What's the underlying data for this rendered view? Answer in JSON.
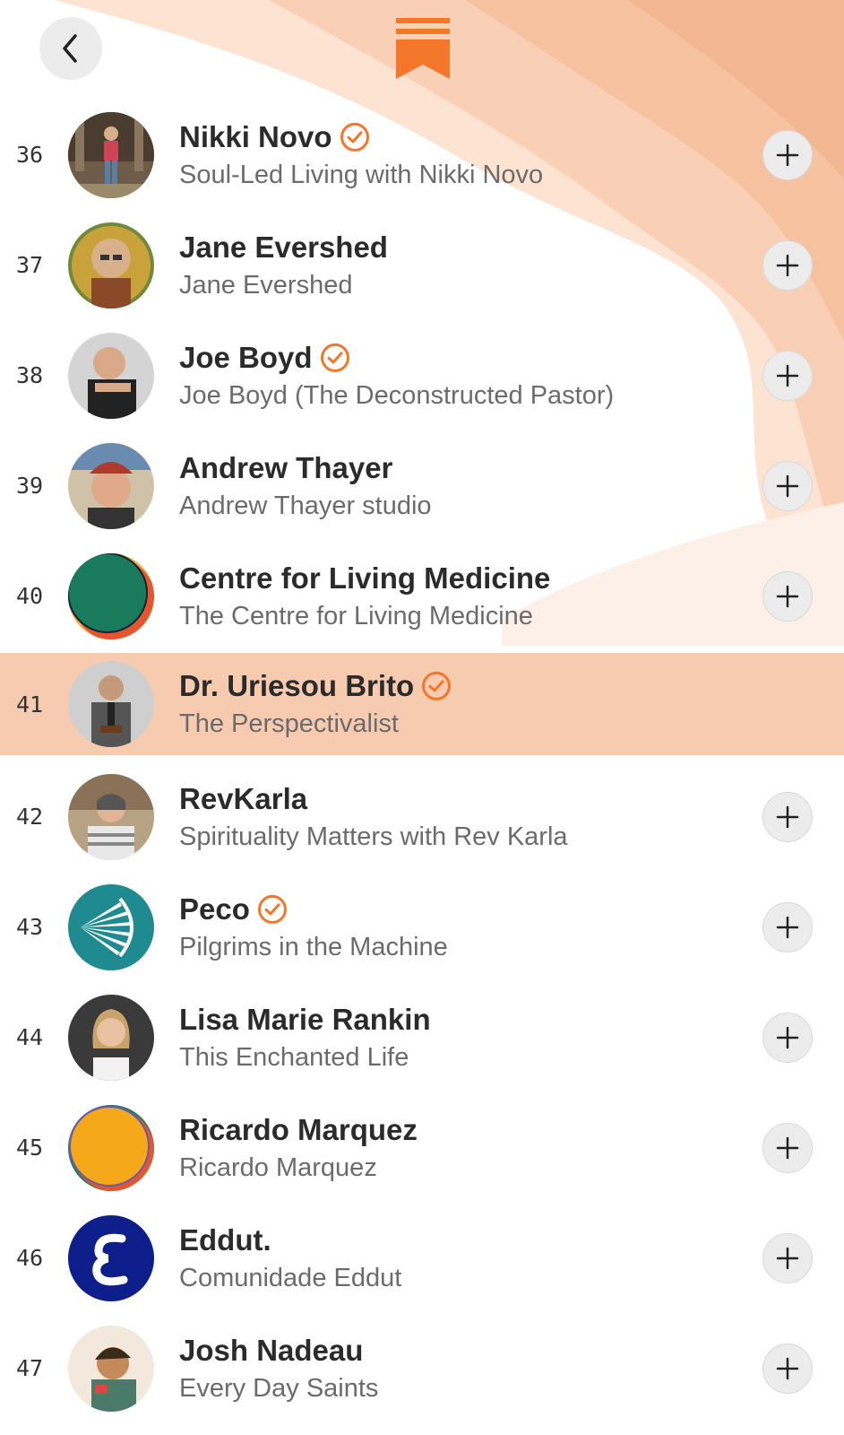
{
  "colors": {
    "accent": "#f4762b",
    "highlight_row": "#f7cbb0",
    "wave_light": "#fde3d2",
    "wave_mid": "#f8c8a8"
  },
  "topbar": {
    "back_icon": "chevron-left-icon",
    "logo_icon": "bookmark-logo-icon"
  },
  "rows": [
    {
      "rank": "36",
      "name": "Nikki Novo",
      "verified": true,
      "publication": "Soul-Led Living with Nikki Novo",
      "highlighted": false
    },
    {
      "rank": "37",
      "name": "Jane Evershed",
      "verified": false,
      "publication": "Jane Evershed",
      "highlighted": false
    },
    {
      "rank": "38",
      "name": "Joe Boyd",
      "verified": true,
      "publication": "Joe Boyd (The Deconstructed Pastor)",
      "highlighted": false
    },
    {
      "rank": "39",
      "name": "Andrew Thayer",
      "verified": false,
      "publication": "Andrew Thayer studio",
      "highlighted": false
    },
    {
      "rank": "40",
      "name": "Centre for Living Medicine",
      "verified": false,
      "publication": "The Centre for Living Medicine",
      "highlighted": false
    },
    {
      "rank": "41",
      "name": "Dr. Uriesou Brito",
      "verified": true,
      "publication": "The Perspectivalist",
      "highlighted": true
    },
    {
      "rank": "42",
      "name": "RevKarla",
      "verified": false,
      "publication": "Spirituality Matters with Rev Karla",
      "highlighted": false
    },
    {
      "rank": "43",
      "name": "Peco",
      "verified": true,
      "publication": "Pilgrims in the Machine",
      "highlighted": false
    },
    {
      "rank": "44",
      "name": "Lisa Marie Rankin",
      "verified": false,
      "publication": "This Enchanted Life",
      "highlighted": false
    },
    {
      "rank": "45",
      "name": "Ricardo Marquez",
      "verified": false,
      "publication": "Ricardo Marquez",
      "highlighted": false
    },
    {
      "rank": "46",
      "name": "Eddut.",
      "verified": false,
      "publication": "Comunidade Eddut",
      "highlighted": false
    },
    {
      "rank": "47",
      "name": "Josh Nadeau",
      "verified": false,
      "publication": "Every Day Saints",
      "highlighted": false
    }
  ]
}
